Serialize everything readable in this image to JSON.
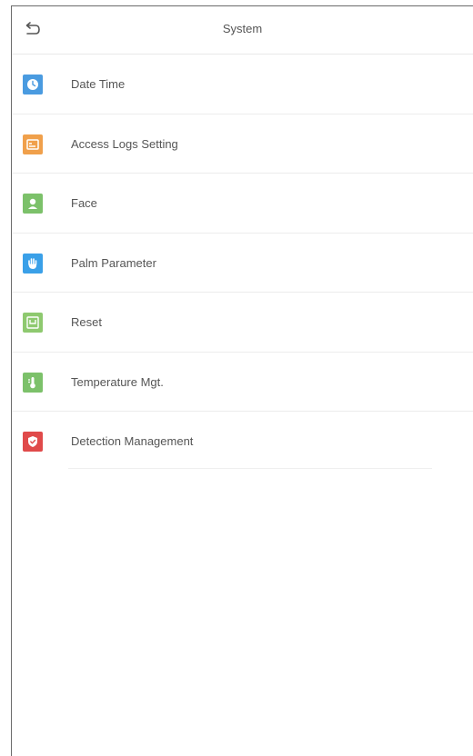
{
  "header": {
    "title": "System"
  },
  "menu": [
    {
      "label": "Date Time",
      "icon": "clock-icon",
      "color": "#4a9be0"
    },
    {
      "label": "Access Logs Setting",
      "icon": "logs-icon",
      "color": "#f0a04b"
    },
    {
      "label": "Face",
      "icon": "face-icon",
      "color": "#7cc16a"
    },
    {
      "label": "Palm Parameter",
      "icon": "palm-icon",
      "color": "#3aa0e8"
    },
    {
      "label": "Reset",
      "icon": "reset-icon",
      "color": "#8ec96f"
    },
    {
      "label": "Temperature Mgt.",
      "icon": "thermometer-icon",
      "color": "#7cc16a"
    },
    {
      "label": "Detection Management",
      "icon": "detection-icon",
      "color": "#e04a4a"
    }
  ]
}
